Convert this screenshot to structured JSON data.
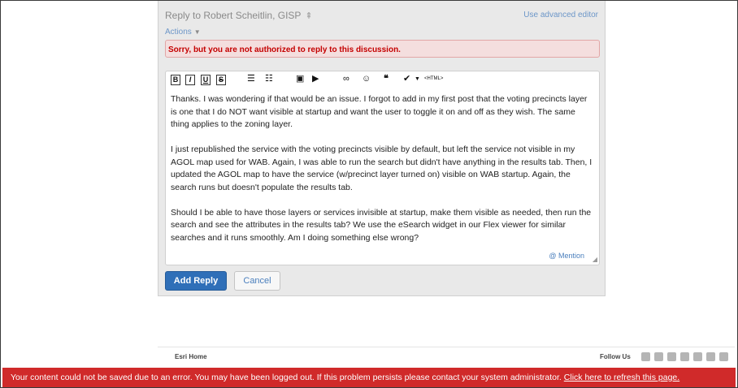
{
  "reply": {
    "title": "Reply to Robert Scheitlin, GISP",
    "advanced_editor_link": "Use advanced editor",
    "actions_label": "Actions",
    "error_message": "Sorry, but you are not authorized to reply to this discussion."
  },
  "toolbar": {
    "bold": "B",
    "italic": "I",
    "underline": "U",
    "strike": "S",
    "html": "<HTML>"
  },
  "editor": {
    "paragraphs": [
      "Thanks.  I was wondering if that would be an issue.  I forgot to add in my first post that the voting precincts layer is one that I do NOT want visible at startup and want the user to toggle it on and off as they wish.  The same thing applies to the zoning layer.",
      "I just republished the service with the voting precincts visible by default, but left the service not visible in my AGOL map used for WAB.  Again, I was able to run the search but didn't have anything in the results tab.  Then, I updated the AGOL map to have the service (w/precinct layer turned on) visible on WAB startup.  Again, the search runs but doesn't populate the results tab.",
      "Should I be able to have those layers or services invisible at startup, make them visible as needed, then run the search and see the attributes in the results tab?  We use the eSearch widget in our Flex viewer for similar searches and it runs smoothly.  Am I doing something else wrong?"
    ],
    "mention_label": "@ Mention"
  },
  "buttons": {
    "add_reply": "Add Reply",
    "cancel": "Cancel"
  },
  "footer": {
    "esri_home": "Esri Home",
    "follow_us": "Follow Us",
    "social_icons": [
      "email-icon",
      "twitter-icon",
      "facebook-icon",
      "linkedin-icon",
      "googleplus-icon",
      "pinterest-icon",
      "rss-icon"
    ]
  },
  "banner": {
    "message": "Your content could not be saved due to an error. You may have been logged out. If this problem persists please contact your system administrator.",
    "refresh_link": "Click here to refresh this page."
  },
  "colors": {
    "primary_button": "#2f6fb8",
    "error_text": "#c40000",
    "banner_bg": "#d02a2a",
    "link": "#6c96c8"
  }
}
